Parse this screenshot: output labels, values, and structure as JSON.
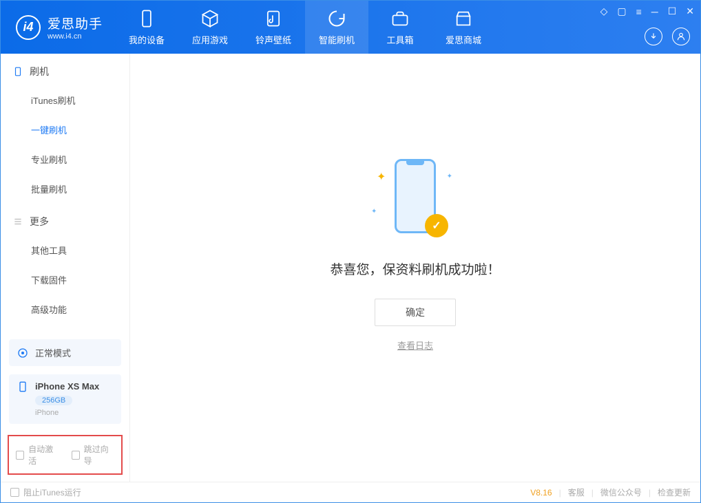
{
  "app": {
    "name": "爱思助手",
    "url": "www.i4.cn"
  },
  "nav": {
    "items": [
      {
        "label": "我的设备"
      },
      {
        "label": "应用游戏"
      },
      {
        "label": "铃声壁纸"
      },
      {
        "label": "智能刷机"
      },
      {
        "label": "工具箱"
      },
      {
        "label": "爱思商城"
      }
    ]
  },
  "sidebar": {
    "group1": {
      "title": "刷机"
    },
    "items1": [
      {
        "label": "iTunes刷机"
      },
      {
        "label": "一键刷机"
      },
      {
        "label": "专业刷机"
      },
      {
        "label": "批量刷机"
      }
    ],
    "group2": {
      "title": "更多"
    },
    "items2": [
      {
        "label": "其他工具"
      },
      {
        "label": "下载固件"
      },
      {
        "label": "高级功能"
      }
    ],
    "mode": "正常模式",
    "device": {
      "name": "iPhone XS Max",
      "capacity": "256GB",
      "os": "iPhone"
    },
    "checks": {
      "auto_activate": "自动激活",
      "skip_guide": "跳过向导"
    }
  },
  "main": {
    "success_msg": "恭喜您，保资料刷机成功啦！",
    "ok_button": "确定",
    "log_link": "查看日志"
  },
  "footer": {
    "block_itunes": "阻止iTunes运行",
    "version": "V8.16",
    "support": "客服",
    "wechat": "微信公众号",
    "update": "检查更新"
  }
}
